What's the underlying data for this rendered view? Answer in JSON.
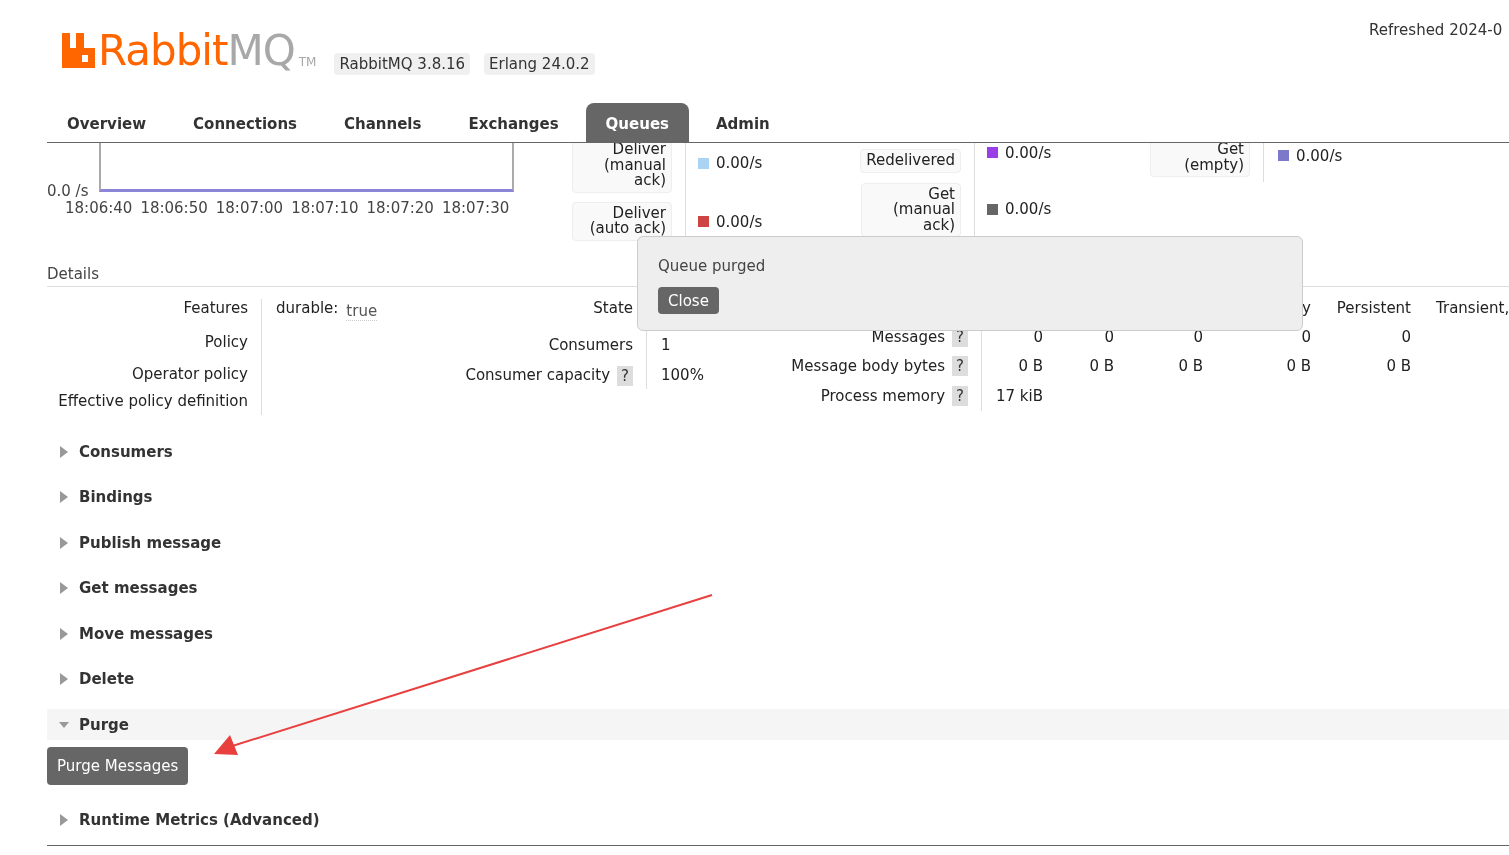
{
  "header": {
    "logo": {
      "brand": "Rabbit",
      "suffix": "MQ",
      "mark": "TM"
    },
    "badges": [
      "RabbitMQ 3.8.16",
      "Erlang 24.0.2"
    ],
    "refreshed": "Refreshed 2024-0"
  },
  "tabs": [
    {
      "label": "Overview",
      "selected": false
    },
    {
      "label": "Connections",
      "selected": false
    },
    {
      "label": "Channels",
      "selected": false
    },
    {
      "label": "Exchanges",
      "selected": false
    },
    {
      "label": "Queues",
      "selected": true
    },
    {
      "label": "Admin",
      "selected": false
    }
  ],
  "rate_chart": {
    "y_label": "0.0 /s",
    "x_labels": [
      "18:06:40",
      "18:06:50",
      "18:07:00",
      "18:07:10",
      "18:07:20",
      "18:07:30"
    ]
  },
  "rate_columns": [
    [
      {
        "label": "Deliver (manual ack)",
        "color": "#aad4f5",
        "value": "0.00/s"
      },
      {
        "label": "Deliver (auto ack)",
        "color": "#cc4444",
        "value": "0.00/s"
      }
    ],
    [
      {
        "label": "Redelivered",
        "color": "#9a3ee8",
        "value": "0.00/s"
      },
      {
        "label": "Get (manual ack)",
        "color": "#666666",
        "value": "0.00/s"
      }
    ],
    [
      {
        "label": "Get (empty)",
        "color": "#7c79c9",
        "value": "0.00/s"
      }
    ]
  ],
  "details": {
    "title": "Details",
    "group_1": [
      {
        "label": "Features",
        "key": "durable:",
        "value": "true"
      },
      {
        "label": "Policy"
      },
      {
        "label": "Operator policy"
      },
      {
        "label": "Effective policy definition"
      }
    ],
    "group_2": [
      {
        "label": "State"
      },
      {
        "label": "Consumers",
        "value": "1"
      },
      {
        "label": "Consumer capacity",
        "help": "?",
        "value": "100%"
      }
    ],
    "message_table": {
      "visible_headers": [
        "y",
        "Persistent",
        "Transient,"
      ],
      "rows": [
        {
          "label": "Messages",
          "help": "?",
          "values": [
            "0",
            "0",
            "0",
            "0",
            "0"
          ]
        },
        {
          "label": "Message body bytes",
          "help": "?",
          "values": [
            "0 B",
            "0 B",
            "0 B",
            "0 B",
            "0 B"
          ]
        },
        {
          "label": "Process memory",
          "help": "?",
          "values": [
            "17 kiB"
          ]
        }
      ]
    }
  },
  "sections": [
    {
      "title": "Consumers",
      "expanded": false
    },
    {
      "title": "Bindings",
      "expanded": false
    },
    {
      "title": "Publish message",
      "expanded": false
    },
    {
      "title": "Get messages",
      "expanded": false
    },
    {
      "title": "Move messages",
      "expanded": false
    },
    {
      "title": "Delete",
      "expanded": false
    },
    {
      "title": "Purge",
      "expanded": true,
      "button": "Purge Messages"
    },
    {
      "title": "Runtime Metrics (Advanced)",
      "expanded": false
    }
  ],
  "popup": {
    "message": "Queue purged",
    "button": "Close"
  },
  "annotation": {
    "kind": "arrow"
  }
}
